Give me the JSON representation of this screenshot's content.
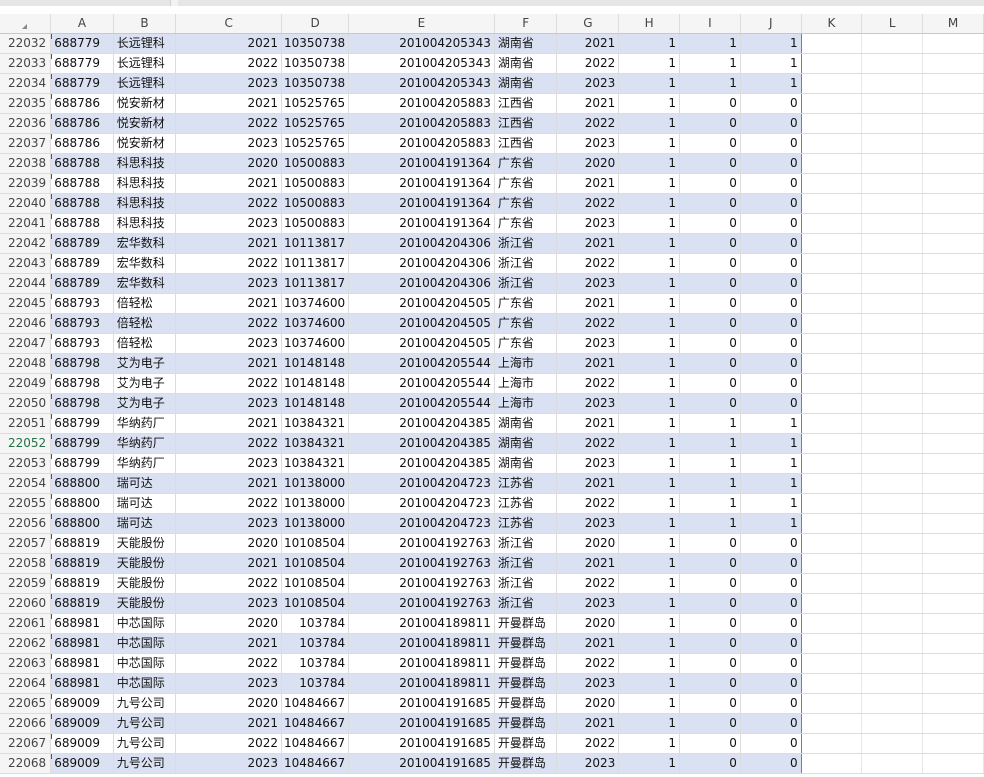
{
  "sheet": {
    "columns": [
      "A",
      "B",
      "C",
      "D",
      "E",
      "F",
      "G",
      "H",
      "I",
      "J",
      "K",
      "L",
      "M"
    ],
    "selected_row": "22052",
    "band_color": "#d9e1f2",
    "rows": [
      {
        "rn": "22032",
        "A": "688779",
        "B": "长远锂科",
        "C": "2021",
        "D": "10350738",
        "E": "201004205343",
        "F": "湖南省",
        "G": "2021",
        "H": "1",
        "I": "1",
        "J": "1"
      },
      {
        "rn": "22033",
        "A": "688779",
        "B": "长远锂科",
        "C": "2022",
        "D": "10350738",
        "E": "201004205343",
        "F": "湖南省",
        "G": "2022",
        "H": "1",
        "I": "1",
        "J": "1"
      },
      {
        "rn": "22034",
        "A": "688779",
        "B": "长远锂科",
        "C": "2023",
        "D": "10350738",
        "E": "201004205343",
        "F": "湖南省",
        "G": "2023",
        "H": "1",
        "I": "1",
        "J": "1"
      },
      {
        "rn": "22035",
        "A": "688786",
        "B": "悦安新材",
        "C": "2021",
        "D": "10525765",
        "E": "201004205883",
        "F": "江西省",
        "G": "2021",
        "H": "1",
        "I": "0",
        "J": "0"
      },
      {
        "rn": "22036",
        "A": "688786",
        "B": "悦安新材",
        "C": "2022",
        "D": "10525765",
        "E": "201004205883",
        "F": "江西省",
        "G": "2022",
        "H": "1",
        "I": "0",
        "J": "0"
      },
      {
        "rn": "22037",
        "A": "688786",
        "B": "悦安新材",
        "C": "2023",
        "D": "10525765",
        "E": "201004205883",
        "F": "江西省",
        "G": "2023",
        "H": "1",
        "I": "0",
        "J": "0"
      },
      {
        "rn": "22038",
        "A": "688788",
        "B": "科思科技",
        "C": "2020",
        "D": "10500883",
        "E": "201004191364",
        "F": "广东省",
        "G": "2020",
        "H": "1",
        "I": "0",
        "J": "0"
      },
      {
        "rn": "22039",
        "A": "688788",
        "B": "科思科技",
        "C": "2021",
        "D": "10500883",
        "E": "201004191364",
        "F": "广东省",
        "G": "2021",
        "H": "1",
        "I": "0",
        "J": "0"
      },
      {
        "rn": "22040",
        "A": "688788",
        "B": "科思科技",
        "C": "2022",
        "D": "10500883",
        "E": "201004191364",
        "F": "广东省",
        "G": "2022",
        "H": "1",
        "I": "0",
        "J": "0"
      },
      {
        "rn": "22041",
        "A": "688788",
        "B": "科思科技",
        "C": "2023",
        "D": "10500883",
        "E": "201004191364",
        "F": "广东省",
        "G": "2023",
        "H": "1",
        "I": "0",
        "J": "0"
      },
      {
        "rn": "22042",
        "A": "688789",
        "B": "宏华数科",
        "C": "2021",
        "D": "10113817",
        "E": "201004204306",
        "F": "浙江省",
        "G": "2021",
        "H": "1",
        "I": "0",
        "J": "0"
      },
      {
        "rn": "22043",
        "A": "688789",
        "B": "宏华数科",
        "C": "2022",
        "D": "10113817",
        "E": "201004204306",
        "F": "浙江省",
        "G": "2022",
        "H": "1",
        "I": "0",
        "J": "0"
      },
      {
        "rn": "22044",
        "A": "688789",
        "B": "宏华数科",
        "C": "2023",
        "D": "10113817",
        "E": "201004204306",
        "F": "浙江省",
        "G": "2023",
        "H": "1",
        "I": "0",
        "J": "0"
      },
      {
        "rn": "22045",
        "A": "688793",
        "B": "倍轻松",
        "C": "2021",
        "D": "10374600",
        "E": "201004204505",
        "F": "广东省",
        "G": "2021",
        "H": "1",
        "I": "0",
        "J": "0"
      },
      {
        "rn": "22046",
        "A": "688793",
        "B": "倍轻松",
        "C": "2022",
        "D": "10374600",
        "E": "201004204505",
        "F": "广东省",
        "G": "2022",
        "H": "1",
        "I": "0",
        "J": "0"
      },
      {
        "rn": "22047",
        "A": "688793",
        "B": "倍轻松",
        "C": "2023",
        "D": "10374600",
        "E": "201004204505",
        "F": "广东省",
        "G": "2023",
        "H": "1",
        "I": "0",
        "J": "0"
      },
      {
        "rn": "22048",
        "A": "688798",
        "B": "艾为电子",
        "C": "2021",
        "D": "10148148",
        "E": "201004205544",
        "F": "上海市",
        "G": "2021",
        "H": "1",
        "I": "0",
        "J": "0"
      },
      {
        "rn": "22049",
        "A": "688798",
        "B": "艾为电子",
        "C": "2022",
        "D": "10148148",
        "E": "201004205544",
        "F": "上海市",
        "G": "2022",
        "H": "1",
        "I": "0",
        "J": "0"
      },
      {
        "rn": "22050",
        "A": "688798",
        "B": "艾为电子",
        "C": "2023",
        "D": "10148148",
        "E": "201004205544",
        "F": "上海市",
        "G": "2023",
        "H": "1",
        "I": "0",
        "J": "0"
      },
      {
        "rn": "22051",
        "A": "688799",
        "B": "华纳药厂",
        "C": "2021",
        "D": "10384321",
        "E": "201004204385",
        "F": "湖南省",
        "G": "2021",
        "H": "1",
        "I": "1",
        "J": "1"
      },
      {
        "rn": "22052",
        "A": "688799",
        "B": "华纳药厂",
        "C": "2022",
        "D": "10384321",
        "E": "201004204385",
        "F": "湖南省",
        "G": "2022",
        "H": "1",
        "I": "1",
        "J": "1"
      },
      {
        "rn": "22053",
        "A": "688799",
        "B": "华纳药厂",
        "C": "2023",
        "D": "10384321",
        "E": "201004204385",
        "F": "湖南省",
        "G": "2023",
        "H": "1",
        "I": "1",
        "J": "1"
      },
      {
        "rn": "22054",
        "A": "688800",
        "B": "瑞可达",
        "C": "2021",
        "D": "10138000",
        "E": "201004204723",
        "F": "江苏省",
        "G": "2021",
        "H": "1",
        "I": "1",
        "J": "1"
      },
      {
        "rn": "22055",
        "A": "688800",
        "B": "瑞可达",
        "C": "2022",
        "D": "10138000",
        "E": "201004204723",
        "F": "江苏省",
        "G": "2022",
        "H": "1",
        "I": "1",
        "J": "1"
      },
      {
        "rn": "22056",
        "A": "688800",
        "B": "瑞可达",
        "C": "2023",
        "D": "10138000",
        "E": "201004204723",
        "F": "江苏省",
        "G": "2023",
        "H": "1",
        "I": "1",
        "J": "1"
      },
      {
        "rn": "22057",
        "A": "688819",
        "B": "天能股份",
        "C": "2020",
        "D": "10108504",
        "E": "201004192763",
        "F": "浙江省",
        "G": "2020",
        "H": "1",
        "I": "0",
        "J": "0"
      },
      {
        "rn": "22058",
        "A": "688819",
        "B": "天能股份",
        "C": "2021",
        "D": "10108504",
        "E": "201004192763",
        "F": "浙江省",
        "G": "2021",
        "H": "1",
        "I": "0",
        "J": "0"
      },
      {
        "rn": "22059",
        "A": "688819",
        "B": "天能股份",
        "C": "2022",
        "D": "10108504",
        "E": "201004192763",
        "F": "浙江省",
        "G": "2022",
        "H": "1",
        "I": "0",
        "J": "0"
      },
      {
        "rn": "22060",
        "A": "688819",
        "B": "天能股份",
        "C": "2023",
        "D": "10108504",
        "E": "201004192763",
        "F": "浙江省",
        "G": "2023",
        "H": "1",
        "I": "0",
        "J": "0"
      },
      {
        "rn": "22061",
        "A": "688981",
        "B": "中芯国际",
        "C": "2020",
        "D": "103784",
        "E": "201004189811",
        "F": "开曼群岛",
        "G": "2020",
        "H": "1",
        "I": "0",
        "J": "0"
      },
      {
        "rn": "22062",
        "A": "688981",
        "B": "中芯国际",
        "C": "2021",
        "D": "103784",
        "E": "201004189811",
        "F": "开曼群岛",
        "G": "2021",
        "H": "1",
        "I": "0",
        "J": "0"
      },
      {
        "rn": "22063",
        "A": "688981",
        "B": "中芯国际",
        "C": "2022",
        "D": "103784",
        "E": "201004189811",
        "F": "开曼群岛",
        "G": "2022",
        "H": "1",
        "I": "0",
        "J": "0"
      },
      {
        "rn": "22064",
        "A": "688981",
        "B": "中芯国际",
        "C": "2023",
        "D": "103784",
        "E": "201004189811",
        "F": "开曼群岛",
        "G": "2023",
        "H": "1",
        "I": "0",
        "J": "0"
      },
      {
        "rn": "22065",
        "A": "689009",
        "B": "九号公司",
        "C": "2020",
        "D": "10484667",
        "E": "201004191685",
        "F": "开曼群岛",
        "G": "2020",
        "H": "1",
        "I": "0",
        "J": "0"
      },
      {
        "rn": "22066",
        "A": "689009",
        "B": "九号公司",
        "C": "2021",
        "D": "10484667",
        "E": "201004191685",
        "F": "开曼群岛",
        "G": "2021",
        "H": "1",
        "I": "0",
        "J": "0"
      },
      {
        "rn": "22067",
        "A": "689009",
        "B": "九号公司",
        "C": "2022",
        "D": "10484667",
        "E": "201004191685",
        "F": "开曼群岛",
        "G": "2022",
        "H": "1",
        "I": "0",
        "J": "0"
      },
      {
        "rn": "22068",
        "A": "689009",
        "B": "九号公司",
        "C": "2023",
        "D": "10484667",
        "E": "201004191685",
        "F": "开曼群岛",
        "G": "2023",
        "H": "1",
        "I": "0",
        "J": "0"
      }
    ]
  }
}
